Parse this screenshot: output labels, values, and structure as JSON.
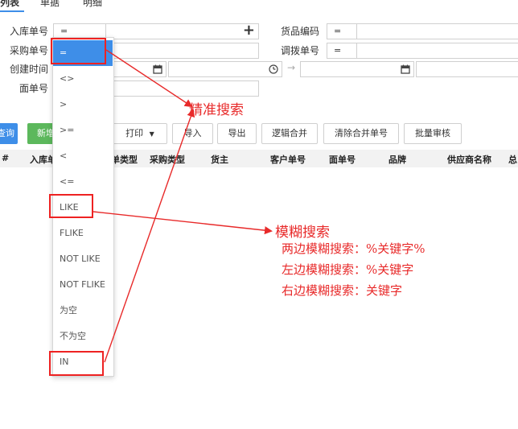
{
  "tabs": [
    "列表",
    "单据",
    "明细"
  ],
  "filters": {
    "inbound_no_label": "入库单号",
    "inbound_no_op": "=",
    "purchase_no_label": "采购单号",
    "create_time_label": "创建时间",
    "face_no_label": "面单号",
    "goods_code_label": "货品编码",
    "goods_code_op": "=",
    "transfer_no_label": "调拨单号",
    "transfer_no_op": "=",
    "range_arrow": "→"
  },
  "toolbar": {
    "query": "查询",
    "add": "新增",
    "print": "打印",
    "import": "导入",
    "export": "导出",
    "logic_merge": "逻辑合并",
    "clear_merge": "清除合并单号",
    "batch_review": "批量审核"
  },
  "table": {
    "columns": [
      "#",
      "入库单号",
      "单类型",
      "采购类型",
      "货主",
      "客户单号",
      "面单号",
      "品牌",
      "供应商名称",
      "总"
    ]
  },
  "dropdown": {
    "options": [
      "=",
      "<>",
      ">",
      ">=",
      "<",
      "<=",
      "LIKE",
      "FLIKE",
      "NOT LIKE",
      "NOT FLIKE",
      "为空",
      "不为空",
      "IN"
    ],
    "selected": "="
  },
  "annotations": {
    "exact": "精准搜索",
    "fuzzy": "模糊搜索",
    "fuzzy_both": "两边模糊搜索：%关键字%",
    "fuzzy_left": "左边模糊搜索：%关键字",
    "fuzzy_right": "右边模糊搜索：关键字"
  },
  "colors": {
    "accent": "#3e8ee8",
    "green": "#5cb85c",
    "annotation_red": "#e82a2a"
  }
}
